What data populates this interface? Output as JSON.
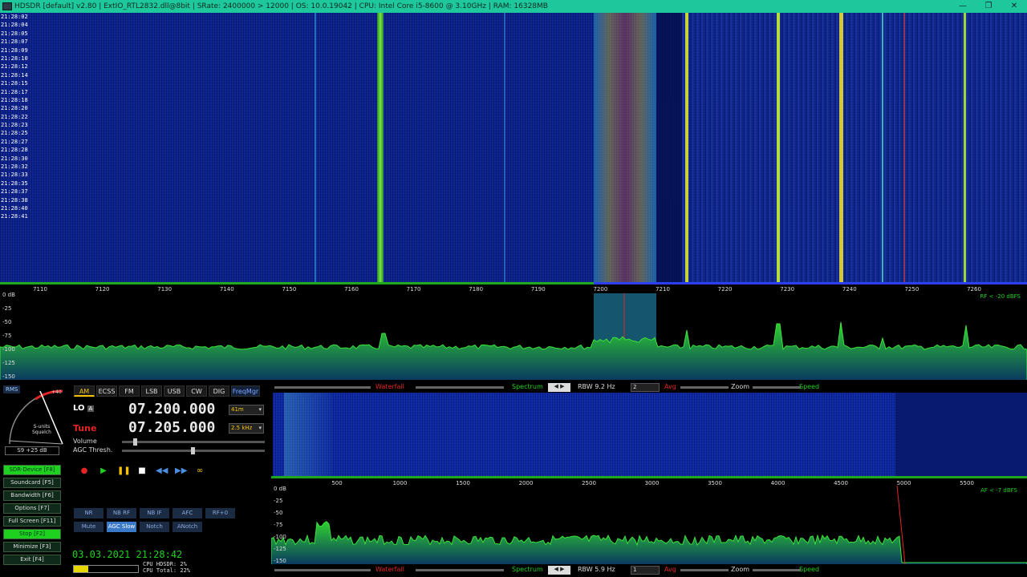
{
  "window": {
    "title": "HDSDR [default]  v2.80   |  ExtIO_RTL2832.dll@8bit  |  SRate: 2400000 > 12000  |  OS: 10.0.19042  |  CPU: Intel Core i5-8600 @ 3.10GHz  |  RAM: 16328MB",
    "buttons": [
      "—",
      "❐",
      "✕"
    ]
  },
  "waterfall": {
    "timestamps": [
      "21:28:02",
      "21:28:04",
      "21:28:05",
      "21:28:07",
      "21:28:09",
      "21:28:10",
      "21:28:12",
      "21:28:14",
      "21:28:15",
      "21:28:17",
      "21:28:18",
      "21:28:20",
      "21:28:22",
      "21:28:23",
      "21:28:25",
      "21:28:27",
      "21:28:28",
      "21:28:30",
      "21:28:32",
      "21:28:33",
      "21:28:35",
      "21:28:37",
      "21:28:38",
      "21:28:40",
      "21:28:41"
    ],
    "bg_color": "#0a1f8a"
  },
  "freq_scale": {
    "labels": [
      "7110",
      "7120",
      "7130",
      "7140",
      "7150",
      "7160",
      "7170",
      "7180",
      "7190",
      "7200",
      "7210",
      "7220",
      "7230",
      "7240",
      "7250",
      "7260"
    ]
  },
  "main_spectrum": {
    "db_labels": [
      "0 dB",
      "-25",
      "-50",
      "-75",
      "-100",
      "-125",
      "-150"
    ],
    "rf_info": "RF < -20 dBFS"
  },
  "smeter": {
    "mode": "RMS",
    "labels": [
      "S-units",
      "Squelch",
      "+40"
    ],
    "reading": "S9 +25 dB"
  },
  "modes": [
    "AM",
    "ECSS",
    "FM",
    "LSB",
    "USB",
    "CW",
    "DIG",
    "FreqMgr"
  ],
  "active_mode": "AM",
  "lo": {
    "label": "LO",
    "tag": "A",
    "value": "07.200.000",
    "band": "41m"
  },
  "tune": {
    "label": "Tune",
    "value": "07.205.000",
    "bandwidth": "2.5 kHz"
  },
  "sliders": {
    "volume": "Volume",
    "agc": "AGC Thresh."
  },
  "transport": [
    "●",
    "▶",
    "❚❚",
    "■",
    "◀◀",
    "▶▶",
    "∞"
  ],
  "side_buttons": [
    "SDR-Device [F8]",
    "Soundcard [F5]",
    "Bandwidth [F6]",
    "Options [F7]",
    "Full Screen [F11]",
    "Stop [F2]",
    "Minimize [F3]",
    "Exit [F4]"
  ],
  "dsp_row1": [
    "NR",
    "NB RF",
    "NB IF",
    "AFC",
    "RF+0"
  ],
  "dsp_row2": [
    "Mute",
    "AGC Slow",
    "Notch",
    "ANotch"
  ],
  "clock": "03.03.2021 21:28:42",
  "cpu": {
    "hdsdr": "CPU HDSDR:  2%",
    "total": "CPU Total: 22%",
    "load": 0.22
  },
  "ctrlbar_top": {
    "waterfall": "Waterfall",
    "spectrum": "Spectrum",
    "rbw": "RBW  9.2 Hz",
    "avg_val": "2",
    "avg": "Avg",
    "zoom": "Zoom",
    "speed": "Speed"
  },
  "ctrlbar_bottom": {
    "waterfall": "Waterfall",
    "spectrum": "Spectrum",
    "rbw": "RBW  5.9 Hz",
    "avg_val": "1",
    "avg": "Avg",
    "zoom": "Zoom",
    "speed": "Speed"
  },
  "af_scale": {
    "labels": [
      "500",
      "1000",
      "1500",
      "2000",
      "2500",
      "3000",
      "3500",
      "4000",
      "4500",
      "5000",
      "5500"
    ]
  },
  "af_spectrum": {
    "db_labels": [
      "0 dB",
      "-25",
      "-50",
      "-75",
      "-100",
      "-125",
      "-150"
    ],
    "af_info": "AF < -7 dBFS"
  },
  "colors": {
    "titlebar": "#1fc79c",
    "accent_green": "#1fd11f",
    "mode_active": "#f3c300",
    "tune_red": "#e42424"
  }
}
